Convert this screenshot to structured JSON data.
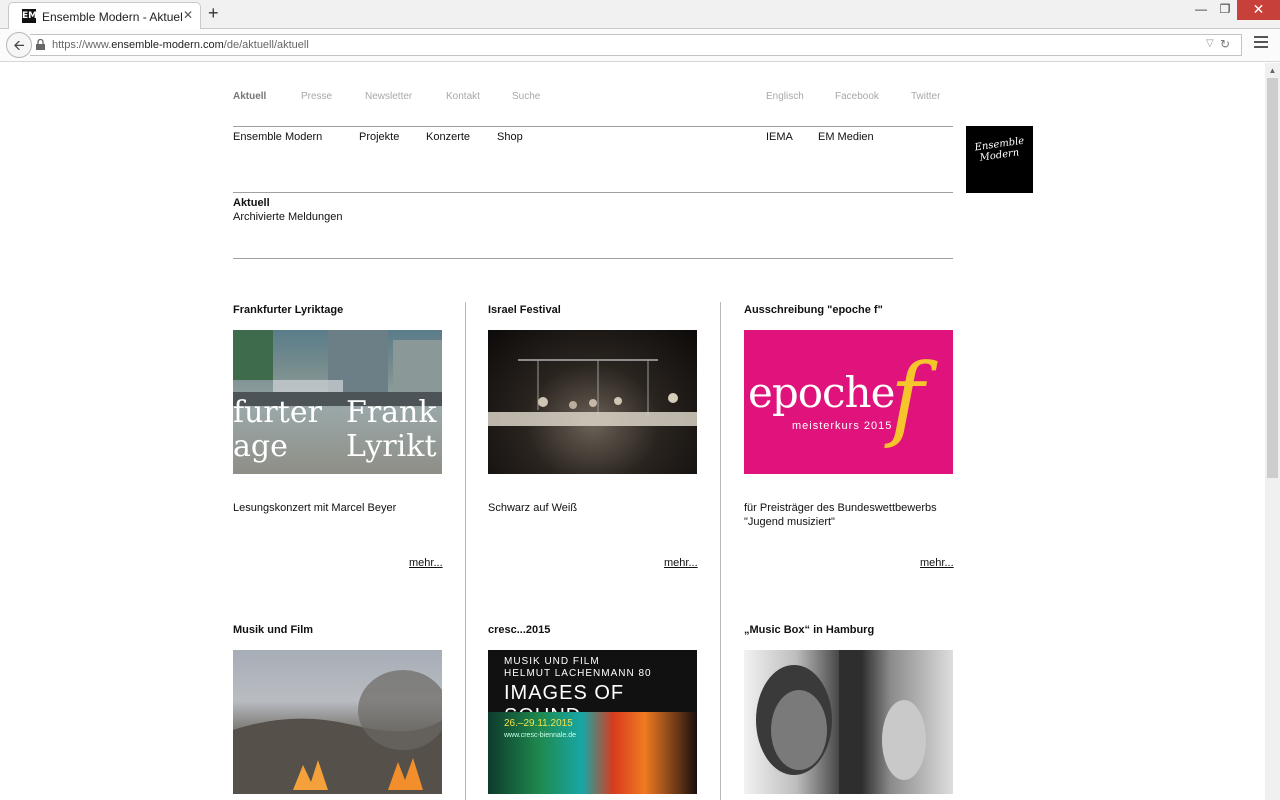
{
  "browser": {
    "tab_title": "Ensemble Modern - Aktuel...",
    "favicon": "EM",
    "close_glyph": "✕",
    "newtab_glyph": "+",
    "url_prefix": "https://www.",
    "url_domain": "ensemble-modern.com",
    "url_path": "/de/aktuell/aktuell"
  },
  "topnav": {
    "left": [
      "Aktuell",
      "Presse",
      "Newsletter",
      "Kontakt",
      "Suche"
    ],
    "right": [
      "Englisch",
      "Facebook",
      "Twitter"
    ]
  },
  "mainnav": {
    "left": [
      "Ensemble Modern",
      "Projekte",
      "Konzerte",
      "Shop"
    ],
    "right": [
      "IEMA",
      "EM Medien"
    ]
  },
  "logo": [
    "Ensemble",
    "Modern"
  ],
  "subnav": {
    "active": "Aktuell",
    "archive": "Archivierte Meldungen"
  },
  "cards": [
    {
      "title": "Frankfurter Lyriktage",
      "desc": "Lesungskonzert mit Marcel Beyer",
      "more": "mehr...",
      "image_text": [
        "furter",
        "Frank",
        "age",
        "Lyrikt"
      ]
    },
    {
      "title": "Israel Festival",
      "desc": "Schwarz auf Weiß",
      "more": "mehr..."
    },
    {
      "title": "Ausschreibung \"epoche f\"",
      "desc": "für Preisträger des Bundeswettbewerbs \"Jugend musiziert\"",
      "more": "mehr...",
      "image_text": [
        "epoche",
        "f",
        "meisterkurs 2015"
      ]
    },
    {
      "title": "Musik und Film"
    },
    {
      "title": "cresc...2015",
      "image_text": [
        "MUSIK UND FILM",
        "HELMUT LACHENMANN 80",
        "IMAGES OF SOUND",
        "26.–29.11.2015",
        "www.cresc-biennale.de"
      ]
    },
    {
      "title": "„Music Box“ in Hamburg"
    }
  ],
  "colors": {
    "accent_close": "#c7403a",
    "epoche_pink": "#e0127c",
    "epoche_yellow": "#f6c52b"
  }
}
